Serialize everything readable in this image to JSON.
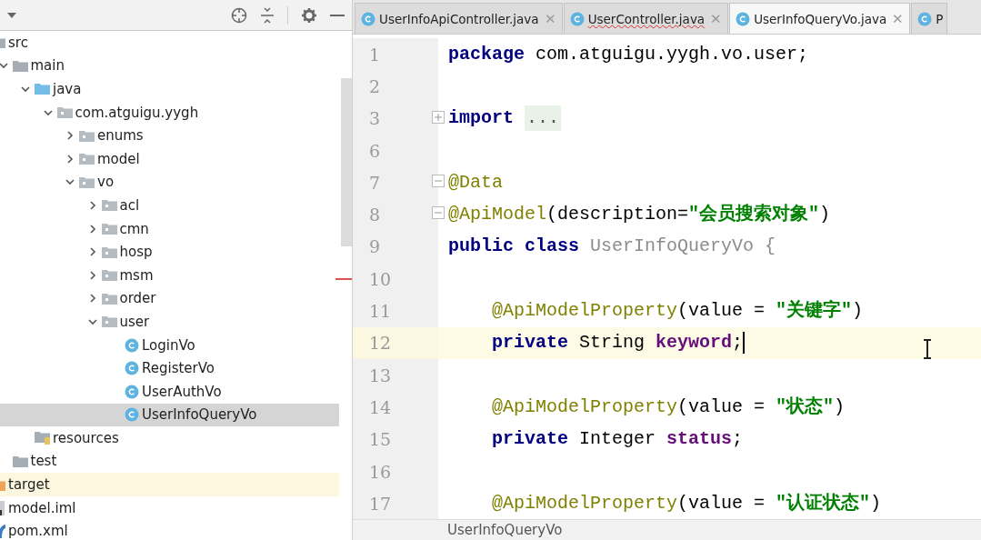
{
  "project_panel": {
    "tree": [
      {
        "name": "src",
        "kind": "folder",
        "selected": false,
        "children": [
          {
            "name": "main",
            "kind": "folder",
            "selected": false,
            "expanded": true,
            "children": [
              {
                "name": "java",
                "kind": "source-folder",
                "selected": false,
                "expanded": true,
                "children": [
                  {
                    "name": "com.atguigu.yygh",
                    "kind": "package",
                    "selected": false,
                    "expanded": true,
                    "children": [
                      {
                        "name": "enums",
                        "kind": "package",
                        "selected": false,
                        "expanded": false
                      },
                      {
                        "name": "model",
                        "kind": "package",
                        "selected": false,
                        "expanded": false
                      },
                      {
                        "name": "vo",
                        "kind": "package",
                        "selected": false,
                        "expanded": true,
                        "children": [
                          {
                            "name": "acl",
                            "kind": "package",
                            "selected": false,
                            "expanded": false
                          },
                          {
                            "name": "cmn",
                            "kind": "package",
                            "selected": false,
                            "expanded": false
                          },
                          {
                            "name": "hosp",
                            "kind": "package",
                            "selected": false,
                            "expanded": false
                          },
                          {
                            "name": "msm",
                            "kind": "package",
                            "selected": false,
                            "expanded": false
                          },
                          {
                            "name": "order",
                            "kind": "package",
                            "selected": false,
                            "expanded": false
                          },
                          {
                            "name": "user",
                            "kind": "package",
                            "selected": false,
                            "expanded": true,
                            "children": [
                              {
                                "name": "LoginVo",
                                "kind": "class",
                                "selected": false
                              },
                              {
                                "name": "RegisterVo",
                                "kind": "class",
                                "selected": false
                              },
                              {
                                "name": "UserAuthVo",
                                "kind": "class",
                                "selected": false
                              },
                              {
                                "name": "UserInfoQueryVo",
                                "kind": "class",
                                "selected": true
                              }
                            ]
                          }
                        ]
                      }
                    ]
                  }
                ]
              },
              {
                "name": "resources",
                "kind": "resources",
                "selected": false
              }
            ]
          },
          {
            "name": "test",
            "kind": "folder",
            "selected": false
          }
        ]
      },
      {
        "name": "target",
        "kind": "excluded",
        "selected": false
      },
      {
        "name": "model.iml",
        "kind": "module",
        "selected": false
      },
      {
        "name": "pom.xml",
        "kind": "maven",
        "selected": false
      }
    ]
  },
  "editor": {
    "tabs": [
      {
        "label": "UserInfoApiController.java",
        "selected": false,
        "error": false,
        "close": "✕"
      },
      {
        "label": "UserController.java",
        "selected": false,
        "error": true,
        "close": "✕"
      },
      {
        "label": "UserInfoQueryVo.java",
        "selected": true,
        "error": false,
        "close": "✕"
      },
      {
        "label": "P",
        "selected": false
      }
    ],
    "lines": [
      {
        "number": "1",
        "current": false,
        "indented": false,
        "tokens": [
          {
            "kind": "keyword",
            "text": "package"
          },
          {
            "kind": "plain",
            "text": " com.atguigu.yygh.vo.user;"
          }
        ]
      },
      {
        "number": "2",
        "current": false
      },
      {
        "number": "3",
        "current": false,
        "indented": false,
        "collapsed": true,
        "tokens": [
          {
            "kind": "keyword",
            "text": "import"
          },
          {
            "kind": "folded",
            "text": "..."
          }
        ]
      },
      {
        "number": "6",
        "current": false
      },
      {
        "number": "7",
        "current": false,
        "indented": false,
        "collapsed": false,
        "tokens": [
          {
            "kind": "annotation",
            "text": "@Data"
          }
        ]
      },
      {
        "number": "8",
        "current": false,
        "indented": false,
        "collapsed": false,
        "tokens": [
          {
            "kind": "annotation",
            "text": "@ApiModel"
          },
          {
            "kind": "plain",
            "text": "(description="
          },
          {
            "kind": "string",
            "text": "\"会员搜索对象\""
          },
          {
            "kind": "plain",
            "text": ")"
          }
        ]
      },
      {
        "number": "9",
        "current": false,
        "indented": false,
        "tokens": [
          {
            "kind": "keyword",
            "text": "public class"
          },
          {
            "kind": "unused",
            "text": " UserInfoQueryVo {"
          }
        ]
      },
      {
        "number": "10",
        "current": false
      },
      {
        "number": "11",
        "current": false,
        "indented": true,
        "tokens": [
          {
            "kind": "annotation",
            "text": "@ApiModelProperty"
          },
          {
            "kind": "plain",
            "text": "(value = "
          },
          {
            "kind": "string",
            "text": "\"关键字\""
          },
          {
            "kind": "plain",
            "text": ")"
          }
        ]
      },
      {
        "number": "12",
        "current": true,
        "indented": true,
        "tokens": [
          {
            "kind": "keyword",
            "text": "private"
          },
          {
            "kind": "plain",
            "text": " String "
          },
          {
            "kind": "field",
            "text": "keyword"
          },
          {
            "kind": "plain",
            "text": ";"
          }
        ]
      },
      {
        "number": "13",
        "current": false
      },
      {
        "number": "14",
        "current": false,
        "indented": true,
        "tokens": [
          {
            "kind": "annotation",
            "text": "@ApiModelProperty"
          },
          {
            "kind": "plain",
            "text": "(value = "
          },
          {
            "kind": "string",
            "text": "\"状态\""
          },
          {
            "kind": "plain",
            "text": ")"
          }
        ]
      },
      {
        "number": "15",
        "current": false,
        "indented": true,
        "tokens": [
          {
            "kind": "keyword",
            "text": "private"
          },
          {
            "kind": "plain",
            "text": " Integer "
          },
          {
            "kind": "field",
            "text": "status"
          },
          {
            "kind": "plain",
            "text": ";"
          }
        ]
      },
      {
        "number": "16",
        "current": false
      },
      {
        "number": "17",
        "current": false,
        "indented": true,
        "tokens": [
          {
            "kind": "annotation",
            "text": "@ApiModelProperty"
          },
          {
            "kind": "plain",
            "text": "(value = "
          },
          {
            "kind": "string",
            "text": "\"认证状态\""
          },
          {
            "kind": "plain",
            "text": ")"
          }
        ]
      }
    ],
    "breadcrumb": "UserInfoQueryVo"
  }
}
